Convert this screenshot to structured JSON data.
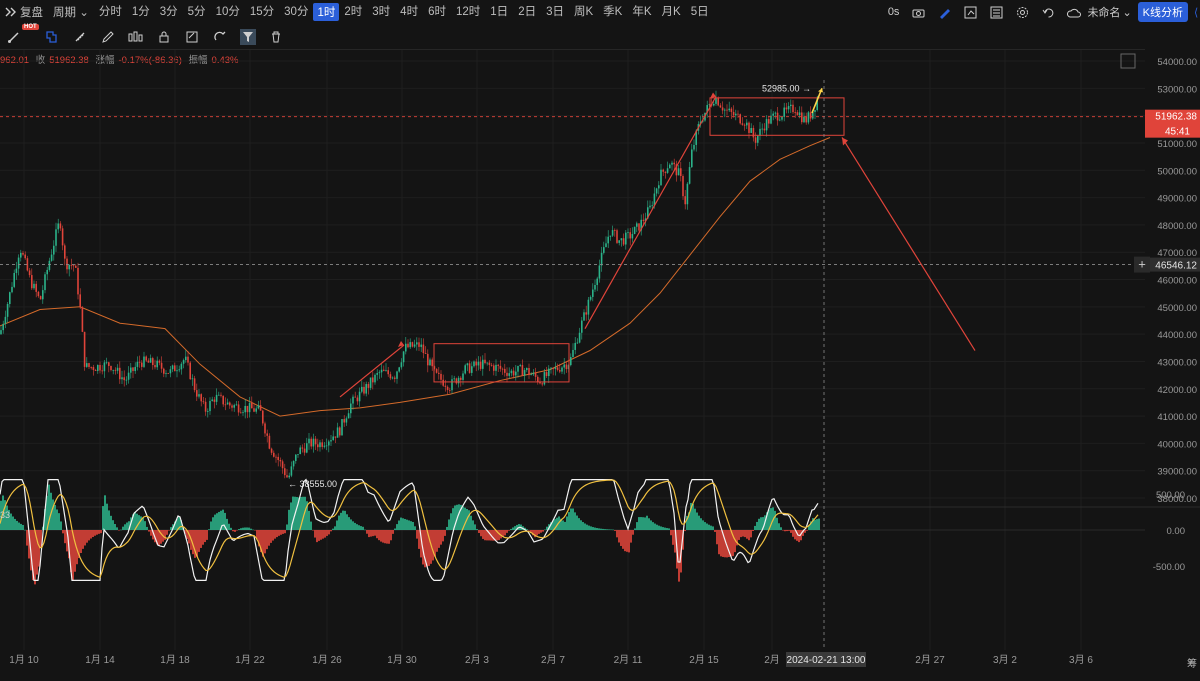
{
  "topbar": {
    "mode": "复盘",
    "period": "周期",
    "intervals": [
      "分时",
      "1分",
      "3分",
      "5分",
      "10分",
      "15分",
      "30分",
      "1时",
      "2时",
      "3时",
      "4时",
      "6时",
      "12时",
      "1日",
      "2日",
      "3日",
      "周K",
      "季K",
      "年K",
      "月K",
      "5日"
    ],
    "active_interval": "1时",
    "right": {
      "timer": "0s",
      "layout_name": "未命名",
      "analysis_button": "K线分析"
    }
  },
  "toolbar": {
    "hot_badge": "HOT"
  },
  "ohlc": {
    "open_partial": "962.01",
    "close_label": "收",
    "close": "51962.38",
    "change_label": "涨幅",
    "change": "-0.17%(-86.36)",
    "amp_label": "振幅",
    "amp": "0.43%"
  },
  "macd": {
    "label": "33"
  },
  "colors": {
    "up": "#2bb38a",
    "down": "#e0443a",
    "ma": "#d46a2a",
    "accent": "#2b5fd9",
    "annotation": "#e0443a",
    "highlight": "#ffd54a"
  },
  "chart_data": {
    "type": "candlestick",
    "price_axis": {
      "ticks": [
        54000,
        53000,
        52000,
        51000,
        50000,
        49000,
        48000,
        47000,
        46000,
        45000,
        44000,
        43000,
        42000,
        41000,
        40000,
        39000,
        38000
      ]
    },
    "time_axis": {
      "ticks": [
        "1月 10",
        "1月 14",
        "1月 18",
        "1月 22",
        "1月 26",
        "1月 30",
        "2月 3",
        "2月 7",
        "2月 11",
        "2月 15",
        "2月",
        "2月 27",
        "3月 2",
        "3月 6"
      ]
    },
    "current_price": "51962.38",
    "countdown": "45:41",
    "crosshair_price": "46546.12",
    "crosshair_time": "2024-02-21 13:00",
    "annotations": {
      "high_label": "52985.00",
      "low_label": "38555.00"
    },
    "macd_axis": {
      "ticks": [
        "500.00",
        "0.00",
        "-500.00"
      ]
    },
    "series_path": [
      [
        0,
        44000
      ],
      [
        10,
        45500
      ],
      [
        20,
        47200
      ],
      [
        30,
        46000
      ],
      [
        40,
        45200
      ],
      [
        50,
        46800
      ],
      [
        60,
        48200
      ],
      [
        65,
        46600
      ],
      [
        75,
        46500
      ],
      [
        80,
        45000
      ],
      [
        85,
        42800
      ],
      [
        95,
        42800
      ],
      [
        110,
        42900
      ],
      [
        125,
        42300
      ],
      [
        140,
        43000
      ],
      [
        155,
        42900
      ],
      [
        170,
        42600
      ],
      [
        185,
        43100
      ],
      [
        195,
        42000
      ],
      [
        205,
        41200
      ],
      [
        215,
        41700
      ],
      [
        230,
        41400
      ],
      [
        245,
        41300
      ],
      [
        260,
        41200
      ],
      [
        270,
        39900
      ],
      [
        280,
        39300
      ],
      [
        288,
        38700
      ],
      [
        298,
        39700
      ],
      [
        310,
        40000
      ],
      [
        320,
        40000
      ],
      [
        330,
        40200
      ],
      [
        340,
        40500
      ],
      [
        350,
        41400
      ],
      [
        365,
        42000
      ],
      [
        380,
        42600
      ],
      [
        395,
        42500
      ],
      [
        405,
        43500
      ],
      [
        420,
        43600
      ],
      [
        435,
        42500
      ],
      [
        450,
        42100
      ],
      [
        465,
        42700
      ],
      [
        480,
        42900
      ],
      [
        495,
        42800
      ],
      [
        510,
        42600
      ],
      [
        525,
        42700
      ],
      [
        540,
        42300
      ],
      [
        555,
        42700
      ],
      [
        570,
        43000
      ],
      [
        580,
        44200
      ],
      [
        590,
        45300
      ],
      [
        600,
        46600
      ],
      [
        610,
        47800
      ],
      [
        620,
        47400
      ],
      [
        630,
        47600
      ],
      [
        640,
        48000
      ],
      [
        650,
        48600
      ],
      [
        660,
        49800
      ],
      [
        670,
        50300
      ],
      [
        680,
        49800
      ],
      [
        685,
        48800
      ],
      [
        692,
        50700
      ],
      [
        700,
        51800
      ],
      [
        708,
        52300
      ],
      [
        715,
        52700
      ],
      [
        725,
        52200
      ],
      [
        735,
        52000
      ],
      [
        745,
        51800
      ],
      [
        755,
        51100
      ],
      [
        765,
        51700
      ],
      [
        775,
        52000
      ],
      [
        785,
        52100
      ],
      [
        795,
        52300
      ],
      [
        805,
        51800
      ],
      [
        812,
        52100
      ],
      [
        820,
        52900
      ]
    ],
    "ma_path": [
      [
        0,
        44300
      ],
      [
        40,
        44900
      ],
      [
        80,
        45000
      ],
      [
        120,
        44400
      ],
      [
        165,
        44200
      ],
      [
        200,
        42900
      ],
      [
        240,
        41700
      ],
      [
        280,
        41000
      ],
      [
        320,
        41200
      ],
      [
        360,
        41300
      ],
      [
        400,
        41500
      ],
      [
        450,
        41800
      ],
      [
        500,
        42300
      ],
      [
        550,
        42700
      ],
      [
        590,
        43400
      ],
      [
        630,
        44400
      ],
      [
        660,
        45500
      ],
      [
        690,
        46900
      ],
      [
        720,
        48300
      ],
      [
        750,
        49600
      ],
      [
        780,
        50400
      ],
      [
        810,
        50900
      ],
      [
        830,
        51200
      ]
    ]
  }
}
